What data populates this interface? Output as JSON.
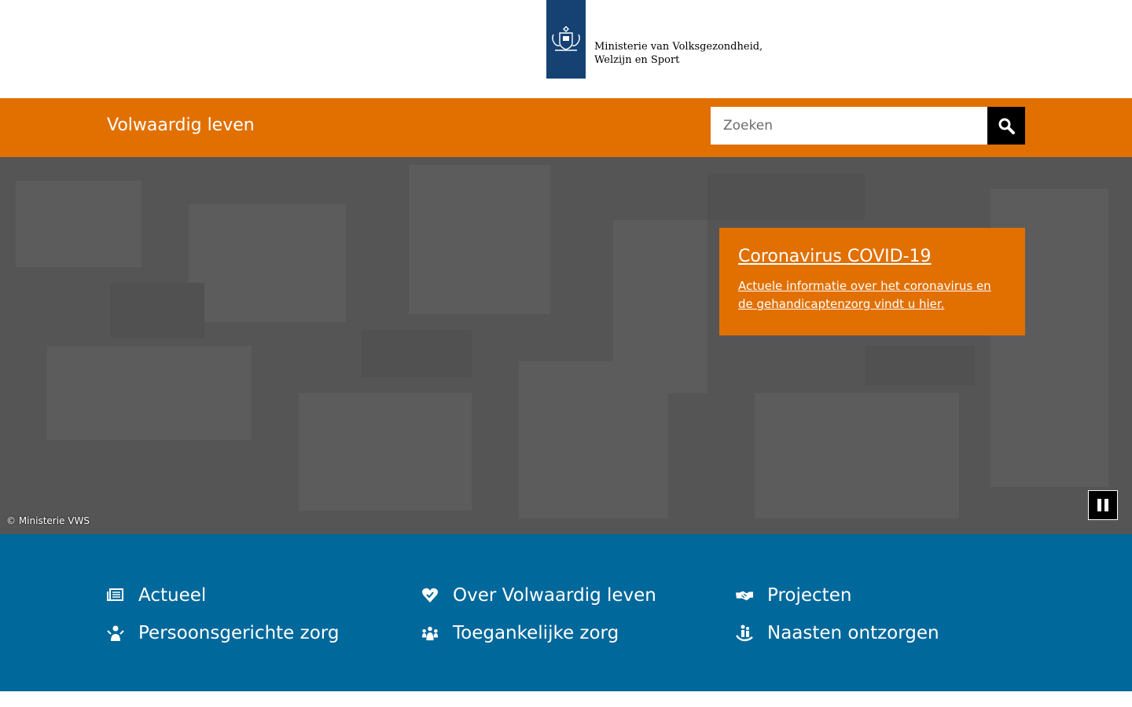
{
  "header": {
    "logo_line1": "Ministerie van Volksgezondheid,",
    "logo_line2": "Welzijn en Sport"
  },
  "topbar": {
    "site_title": "Volwaardig leven",
    "search_placeholder": "Zoeken",
    "search_icon": "search-icon"
  },
  "hero": {
    "credit": "© Ministerie VWS",
    "callout_title": "Coronavirus COVID-19",
    "callout_body": "Actuele informatie over het coronavirus en de gehandicaptenzorg vindt u hier."
  },
  "nav": {
    "items": [
      {
        "label": "Actueel",
        "icon": "newspaper-icon"
      },
      {
        "label": "Over Volwaardig leven",
        "icon": "heart-icon"
      },
      {
        "label": "Projecten",
        "icon": "handshake-icon"
      },
      {
        "label": "Persoonsgerichte zorg",
        "icon": "person-care-icon"
      },
      {
        "label": "Toegankelijke zorg",
        "icon": "people-icon"
      },
      {
        "label": "Naasten ontzorgen",
        "icon": "caregiver-icon"
      }
    ]
  },
  "colors": {
    "orange": "#e17000",
    "blue": "#01689b",
    "logo_blue": "#154273"
  }
}
